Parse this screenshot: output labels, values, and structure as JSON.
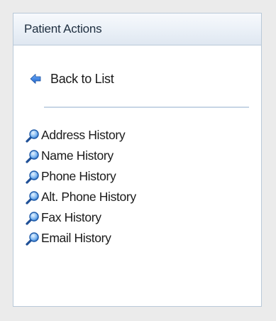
{
  "panel": {
    "title": "Patient Actions"
  },
  "back": {
    "label": "Back to List",
    "icon": "arrow-left-icon"
  },
  "history": {
    "icon": "magnifier-icon",
    "items": [
      {
        "label": "Address History"
      },
      {
        "label": "Name History"
      },
      {
        "label": "Phone History"
      },
      {
        "label": "Alt. Phone History"
      },
      {
        "label": "Fax History"
      },
      {
        "label": "Email History"
      }
    ]
  },
  "colors": {
    "panel_border": "#b9c9d8",
    "header_bg": "#e6edf5",
    "divider": "#c7d5e5",
    "icon_blue": "#2a7ad8"
  }
}
